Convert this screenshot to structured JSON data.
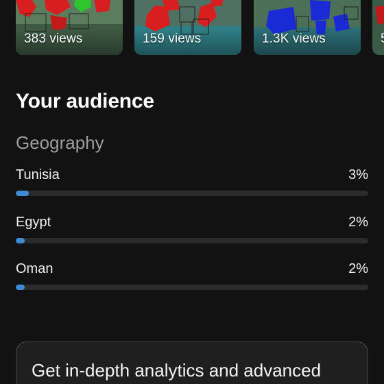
{
  "thumbnails": [
    {
      "views": "383 views"
    },
    {
      "views": "159 views"
    },
    {
      "views": "1.3K views"
    },
    {
      "views": "5"
    }
  ],
  "audience": {
    "title": "Your audience",
    "geography": {
      "title": "Geography",
      "rows": [
        {
          "country": "Tunisia",
          "percent_label": "3%",
          "percent": 3
        },
        {
          "country": "Egypt",
          "percent_label": "2%",
          "percent": 2
        },
        {
          "country": "Oman",
          "percent_label": "2%",
          "percent": 2
        }
      ]
    }
  },
  "promo": {
    "text": "Get in-depth analytics and advanced"
  },
  "colors": {
    "background": "#121212",
    "bar_fill": "#3d8bd6",
    "bar_track": "#2b2b2b"
  }
}
